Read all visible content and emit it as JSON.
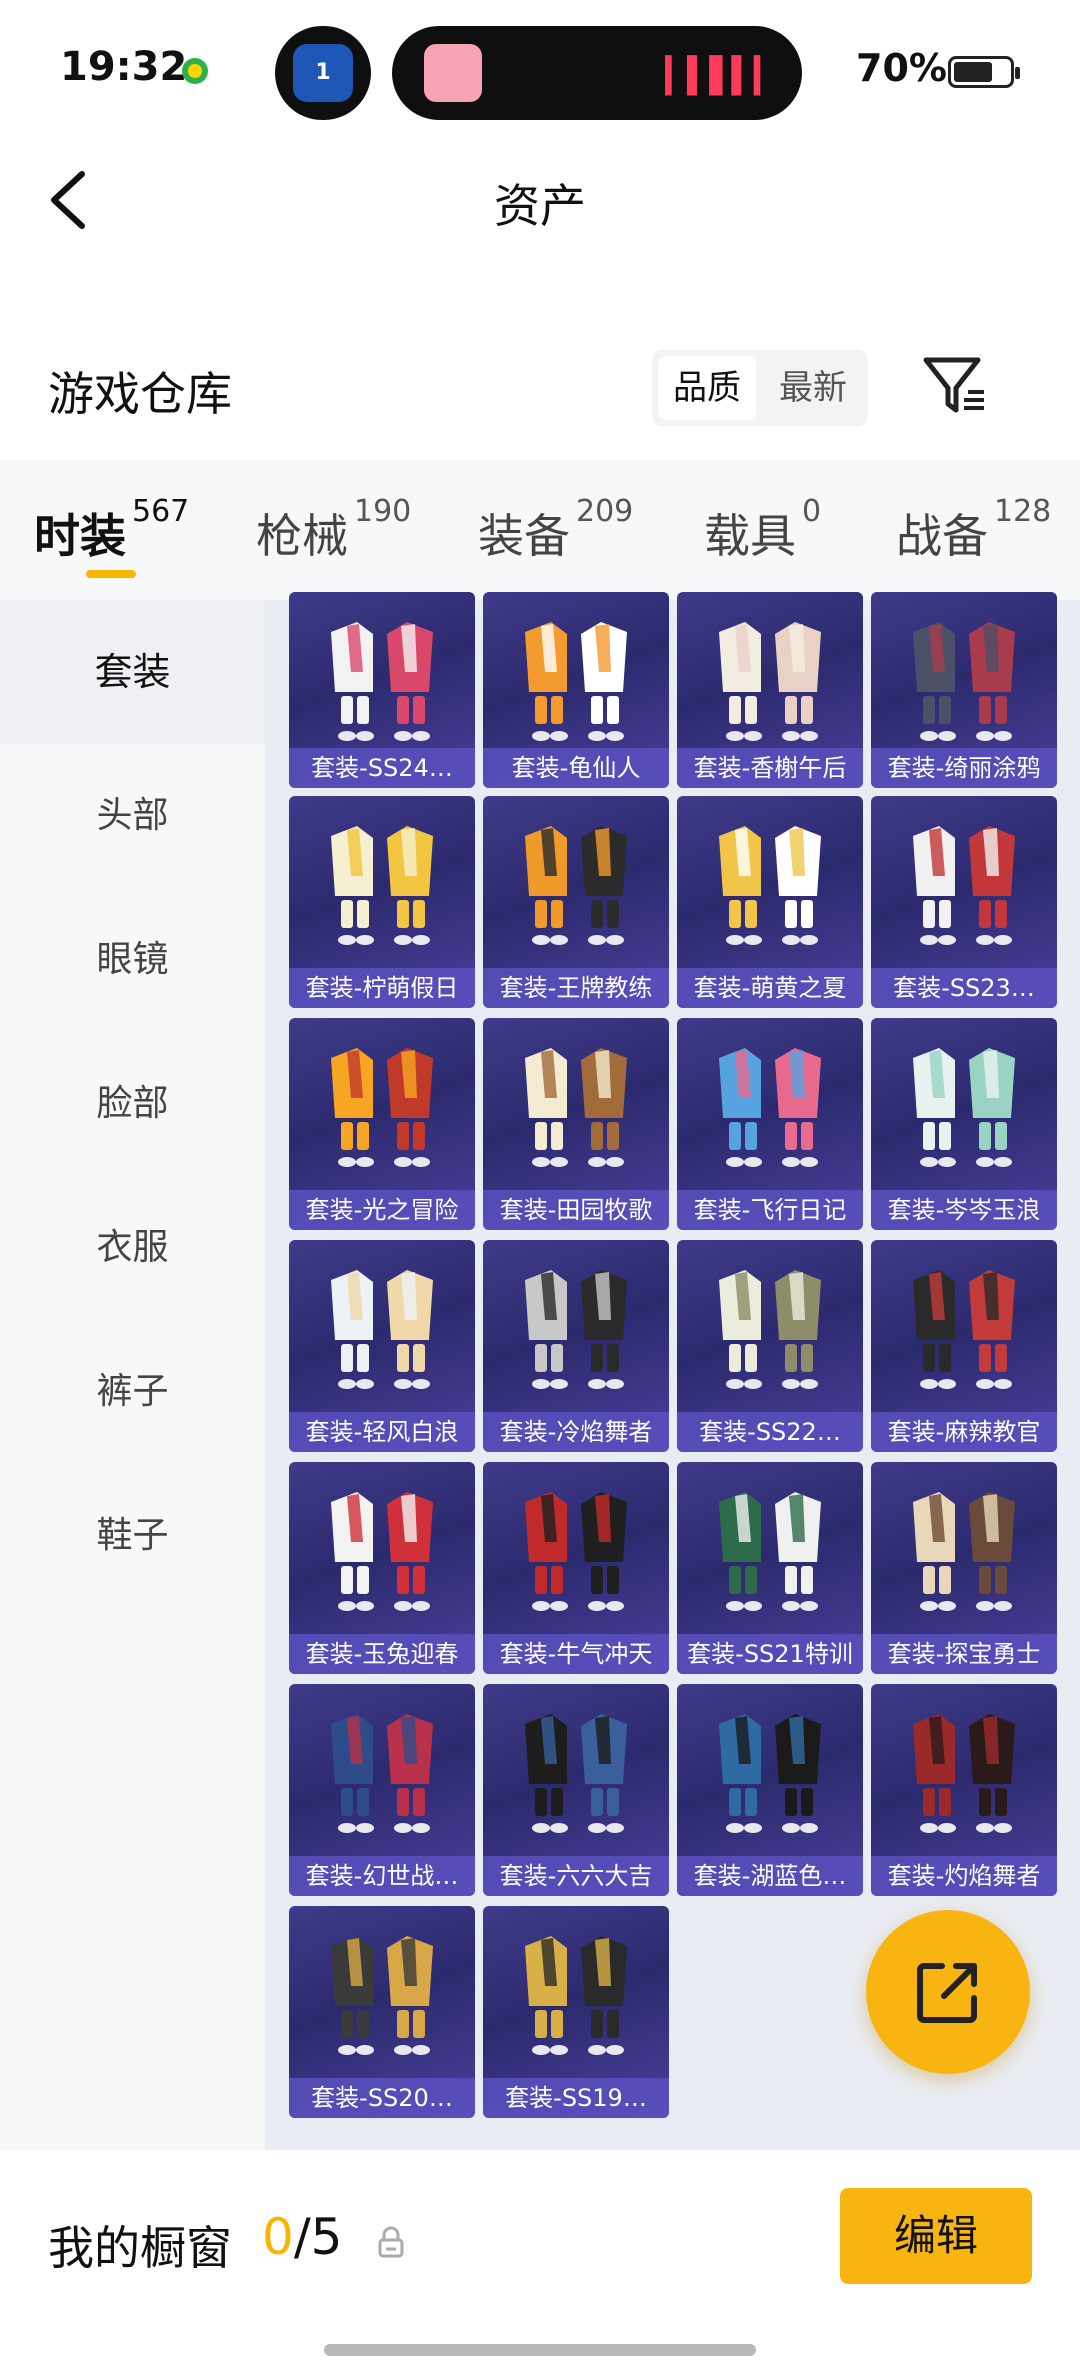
{
  "status_bar": {
    "time": "19:32",
    "battery_text": "70%",
    "battery_level": 0.7,
    "call_badge": "1"
  },
  "header": {
    "title": "资产"
  },
  "warehouse": {
    "title": "游戏仓库",
    "sort_options": [
      "品质",
      "最新"
    ],
    "active_sort": "品质"
  },
  "tabs": [
    {
      "label": "时装",
      "count": "567",
      "active": true
    },
    {
      "label": "枪械",
      "count": "190"
    },
    {
      "label": "装备",
      "count": "209"
    },
    {
      "label": "载具",
      "count": "0"
    },
    {
      "label": "战备",
      "count": "128"
    }
  ],
  "sidebar": [
    "套装",
    "头部",
    "眼镜",
    "脸部",
    "衣服",
    "裤子",
    "鞋子"
  ],
  "items": [
    {
      "label": "套装-SS24…",
      "colors": [
        "#f2f2f2",
        "#d9486a"
      ]
    },
    {
      "label": "套装-龟仙人",
      "colors": [
        "#f39b2f",
        "#ffffff"
      ]
    },
    {
      "label": "套装-香榭午后",
      "colors": [
        "#f3ece0",
        "#e9d2c5"
      ]
    },
    {
      "label": "套装-绮丽涂鸦",
      "colors": [
        "#4b5068",
        "#a83b4c"
      ]
    },
    {
      "label": "套装-柠萌假日",
      "colors": [
        "#f5f0d0",
        "#f2c640"
      ]
    },
    {
      "label": "套装-王牌教练",
      "colors": [
        "#f09a2a",
        "#2b2b2b"
      ]
    },
    {
      "label": "套装-萌黄之夏",
      "colors": [
        "#f0c54a",
        "#ffffff"
      ]
    },
    {
      "label": "套装-SS23…",
      "colors": [
        "#f1f1f1",
        "#c2373a"
      ]
    },
    {
      "label": "套装-光之冒险",
      "colors": [
        "#f6a623",
        "#c0392b"
      ]
    },
    {
      "label": "套装-田园牧歌",
      "colors": [
        "#f4ecd0",
        "#a26b3a"
      ]
    },
    {
      "label": "套装-飞行日记",
      "colors": [
        "#57a3e0",
        "#e86a8e"
      ]
    },
    {
      "label": "套装-岑岑玉浪",
      "colors": [
        "#e8f3ef",
        "#9ad3c4"
      ]
    },
    {
      "label": "套装-轻风白浪",
      "colors": [
        "#eef2f7",
        "#f0d8a8"
      ]
    },
    {
      "label": "套装-冷焰舞者",
      "colors": [
        "#c8c8c8",
        "#2a2a2a"
      ]
    },
    {
      "label": "套装-SS22…",
      "colors": [
        "#ececdc",
        "#8d8d6a"
      ]
    },
    {
      "label": "套装-麻辣教官",
      "colors": [
        "#2a2a2a",
        "#c23a3a"
      ]
    },
    {
      "label": "套装-玉兔迎春",
      "colors": [
        "#f3f3f3",
        "#d0303a"
      ]
    },
    {
      "label": "套装-牛气冲天",
      "colors": [
        "#c02a2a",
        "#1f1f1f"
      ]
    },
    {
      "label": "套装-SS21特训",
      "colors": [
        "#2d6b4a",
        "#f0f0f0"
      ]
    },
    {
      "label": "套装-探宝勇士",
      "colors": [
        "#e8d7b8",
        "#6a4a3a"
      ]
    },
    {
      "label": "套装-幻世战…",
      "colors": [
        "#2f4c8a",
        "#b8304a"
      ]
    },
    {
      "label": "套装-六六大吉",
      "colors": [
        "#1d1d1d",
        "#3a5f9a"
      ]
    },
    {
      "label": "套装-湖蓝色…",
      "colors": [
        "#2f6aa3",
        "#1a1a1a"
      ]
    },
    {
      "label": "套装-灼焰舞者",
      "colors": [
        "#9a2a2a",
        "#2a1a1a"
      ]
    },
    {
      "label": "套装-SS20…",
      "colors": [
        "#3a3a3a",
        "#d8a848"
      ]
    },
    {
      "label": "套装-SS19…",
      "colors": [
        "#d8b048",
        "#2a2a2a"
      ]
    }
  ],
  "bottom": {
    "showcase_label": "我的橱窗",
    "showcase_current": "0",
    "showcase_total": "/5",
    "edit_label": "编辑"
  },
  "accent_color": "#f8b511"
}
